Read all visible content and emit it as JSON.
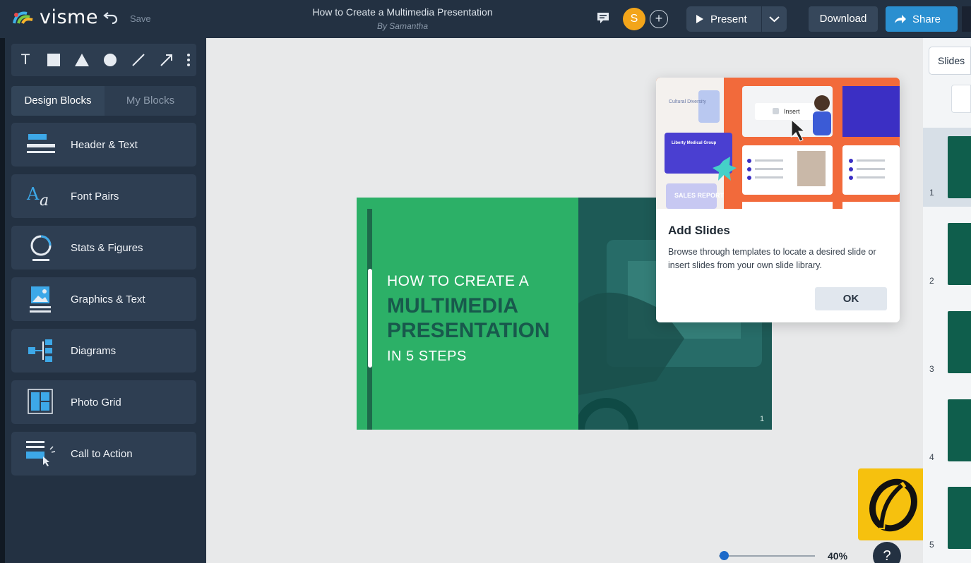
{
  "app": {
    "logo_text": "visme",
    "save_label": "Save"
  },
  "document": {
    "title": "How to Create a Multimedia Presentation",
    "author": "By Samantha"
  },
  "topbar": {
    "avatar_initial": "S",
    "add_collaborator": "+",
    "present_label": "Present",
    "download_label": "Download",
    "share_label": "Share"
  },
  "tools": [
    "T",
    "square",
    "triangle",
    "circle",
    "line",
    "arrow",
    "more"
  ],
  "sidebar": {
    "tabs": [
      {
        "label": "Design Blocks",
        "active": true
      },
      {
        "label": "My Blocks",
        "active": false
      }
    ],
    "blocks": [
      {
        "label": "Header & Text",
        "icon": "header-text-icon"
      },
      {
        "label": "Font Pairs",
        "icon": "font-pairs-icon"
      },
      {
        "label": "Stats & Figures",
        "icon": "stats-figures-icon"
      },
      {
        "label": "Graphics & Text",
        "icon": "graphics-text-icon"
      },
      {
        "label": "Diagrams",
        "icon": "diagrams-icon"
      },
      {
        "label": "Photo Grid",
        "icon": "photo-grid-icon"
      },
      {
        "label": "Call to Action",
        "icon": "call-to-action-icon"
      }
    ]
  },
  "slide": {
    "line1": "HOW TO CREATE A",
    "line2": "MULTIMEDIA",
    "line3": "PRESENTATION",
    "line4": "IN 5 STEPS",
    "number": "1"
  },
  "popup": {
    "title": "Add Slides",
    "description": "Browse through templates to locate a desired slide or insert slides from your own slide library.",
    "ok_label": "OK",
    "image_texts": {
      "insert": "Insert",
      "group": "Liberty Medical Group",
      "sales": "SALES REPORT",
      "cultural": "Cultural Diversity"
    }
  },
  "zoom": {
    "value": "40%"
  },
  "help_label": "?",
  "rightpanel": {
    "header_label": "Slides",
    "thumbnails": [
      {
        "number": "1",
        "selected": true
      },
      {
        "number": "2"
      },
      {
        "number": "3"
      },
      {
        "number": "4"
      },
      {
        "number": "5"
      }
    ]
  },
  "colors": {
    "topbar": "#233142",
    "accent_blue": "#2a8fd0",
    "slide_green": "#2cb067",
    "slide_dark": "#18594c",
    "avatar": "#f3a51a",
    "badge": "#f6c10e"
  }
}
